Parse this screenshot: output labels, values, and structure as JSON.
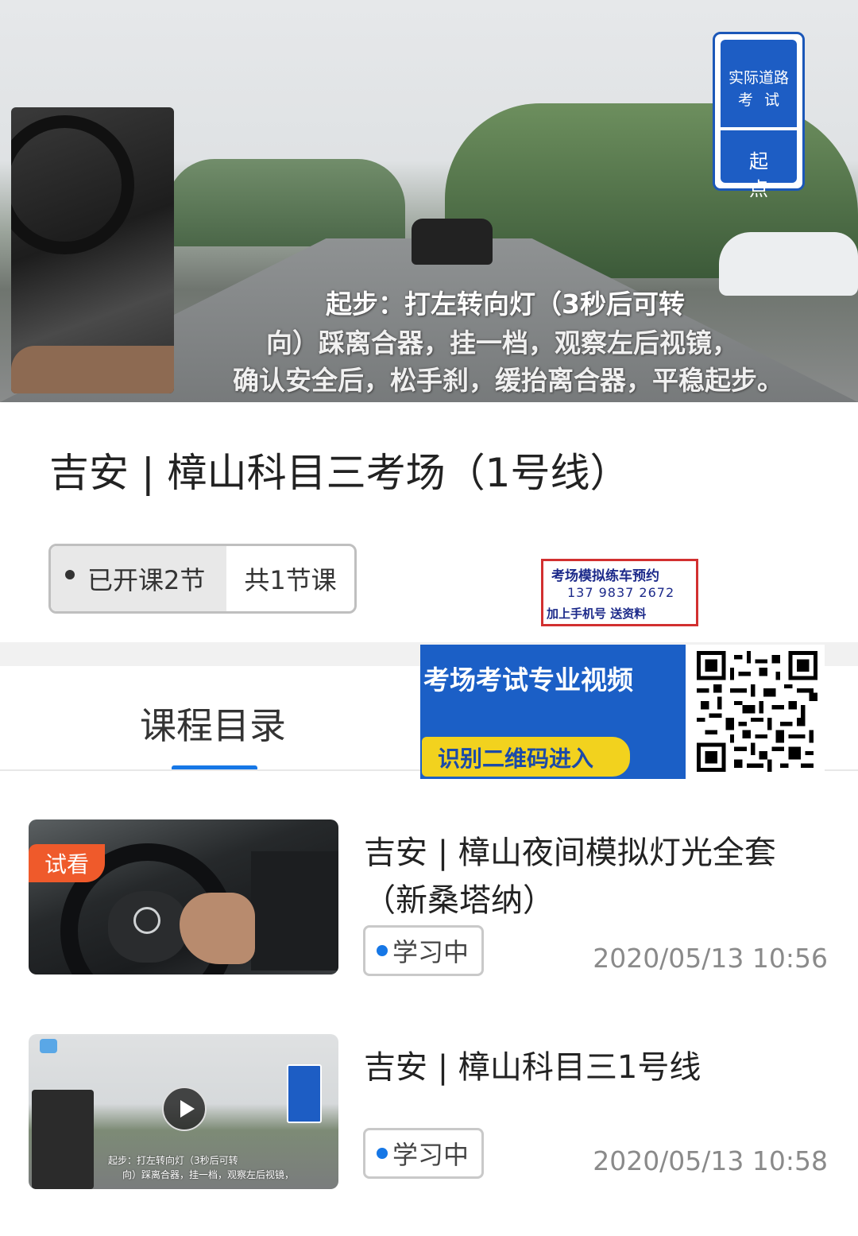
{
  "hero": {
    "sign_line1": "实际道路",
    "sign_line2": "考试",
    "sign_line3": "起点",
    "caption1": "起步：打左转向灯（3秒后可转",
    "caption2": "向）踩离合器，挂一档，观察左后视镜，",
    "caption3": "确认安全后，松手刹，缓抬离合器，平稳起步。"
  },
  "course": {
    "title": "吉安 | 樟山科目三考场（1号线）",
    "opened_label": "已开课2节",
    "total_label": "共1节课"
  },
  "promo": {
    "line1": "考场模拟练车预约",
    "phone": "137  9837  2672",
    "line3": "加上手机号   送资料"
  },
  "banner": {
    "headline": "考场考试专业视频",
    "button": "识别二维码进入"
  },
  "tabs": {
    "catalog": "课程目录"
  },
  "lessons": [
    {
      "badge": "试看",
      "title": "吉安 | 樟山夜间模拟灯光全套（新桑塔纳）",
      "status": "学习中",
      "date": "2020/05/13 10:56"
    },
    {
      "title": "吉安 | 樟山科目三1号线",
      "status": "学习中",
      "date": "2020/05/13 10:58",
      "thumb_caption1": "起步：打左转向灯（3秒后可转",
      "thumb_caption2": "向）踩离合器，挂一档，观察左后视镜，"
    }
  ],
  "colors": {
    "accent": "#1677e6",
    "badge": "#ef5a2b",
    "banner": "#1b5fc6"
  }
}
